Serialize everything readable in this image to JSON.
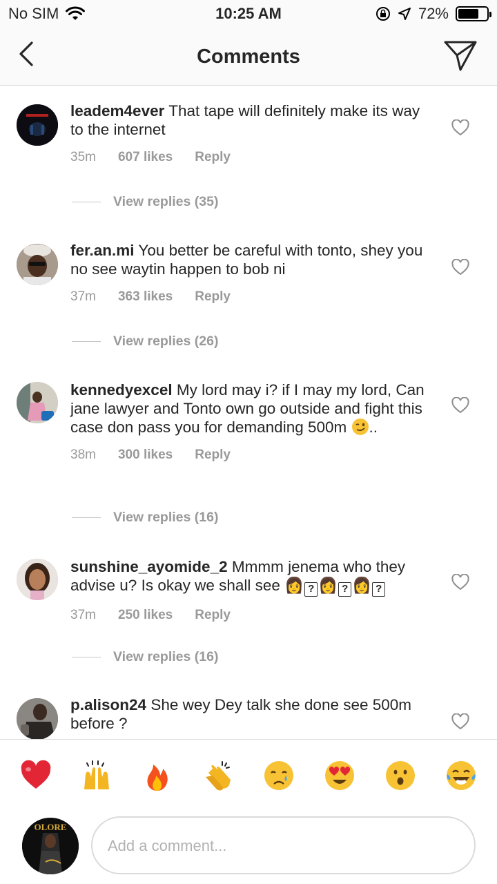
{
  "status_bar": {
    "carrier": "No SIM",
    "time": "10:25 AM",
    "battery": "72%"
  },
  "header": {
    "title": "Comments"
  },
  "comments": [
    {
      "username": "leadem4ever",
      "text": "That tape will definitely make its way to the internet",
      "time": "35m",
      "likes": "607 likes",
      "reply": "Reply",
      "view_replies": "View replies (35)"
    },
    {
      "username": "fer.an.mi",
      "text": "You better be careful with tonto, shey you no see waytin happen to bob ni",
      "time": "37m",
      "likes": "363 likes",
      "reply": "Reply",
      "view_replies": "View replies (26)"
    },
    {
      "username": "kennedyexcel",
      "text": "My lord may i? if I may my lord, Can jane lawyer and Tonto own go outside and fight this case don pass you for demanding 500m",
      "text_suffix": "..",
      "time": "38m",
      "likes": "300 likes",
      "reply": "Reply",
      "view_replies": "View replies (16)"
    },
    {
      "username": "sunshine_ayomide_2",
      "text": "Mmmm jenema who they advise u? Is okay we shall see",
      "time": "37m",
      "likes": "250 likes",
      "reply": "Reply",
      "view_replies": "View replies (16)"
    },
    {
      "username": "p.alison24",
      "text": "She wey Dey talk she done see 500m before ?"
    }
  ],
  "emoji_bar": [
    "heart-emoji",
    "raised-hands-emoji",
    "fire-emoji",
    "clapping-emoji",
    "crying-emoji",
    "heart-eyes-emoji",
    "surprised-emoji",
    "tears-of-joy-emoji"
  ],
  "composer": {
    "placeholder": "Add a comment...",
    "avatar_text": "OLORE"
  },
  "colors": {
    "text": "#262626",
    "meta": "#999999",
    "divider": "#dbdbdb",
    "heart_red": "#ed4956"
  }
}
